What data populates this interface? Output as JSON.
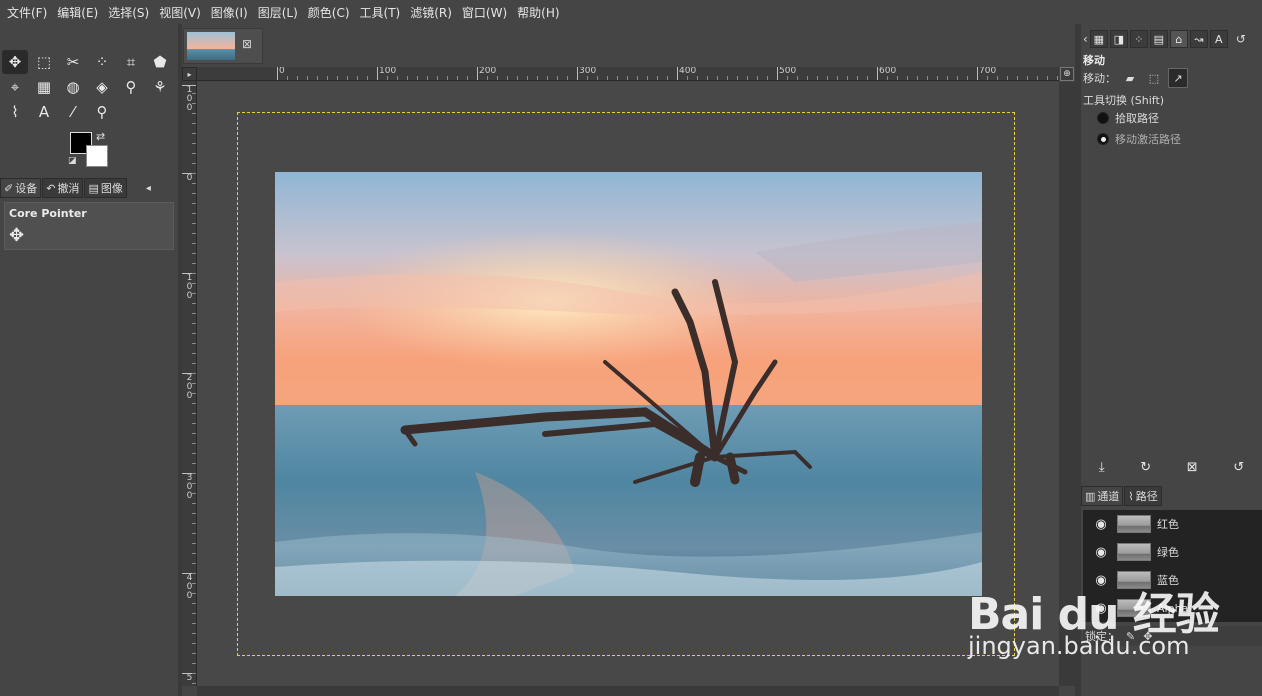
{
  "menubar": {
    "items": [
      "文件(F)",
      "编辑(E)",
      "选择(S)",
      "视图(V)",
      "图像(I)",
      "图层(L)",
      "颜色(C)",
      "工具(T)",
      "滤镜(R)",
      "窗口(W)",
      "帮助(H)"
    ]
  },
  "toolbox": {
    "tools": [
      {
        "name": "move-tool-icon",
        "glyph": "✥"
      },
      {
        "name": "rect-select-icon",
        "glyph": "⬚"
      },
      {
        "name": "scissors-select-icon",
        "glyph": "✂"
      },
      {
        "name": "fuzzy-select-icon",
        "glyph": "⁘"
      },
      {
        "name": "crop-icon",
        "glyph": "⌗"
      },
      {
        "name": "transform-icon",
        "glyph": "⬟"
      },
      {
        "name": "perspective-icon",
        "glyph": "⌖"
      },
      {
        "name": "warp-icon",
        "glyph": "▦"
      },
      {
        "name": "bucket-fill-icon",
        "glyph": "◍"
      },
      {
        "name": "eraser-icon",
        "glyph": "◈"
      },
      {
        "name": "clone-icon",
        "glyph": "⚲"
      },
      {
        "name": "smudge-icon",
        "glyph": "⚘"
      },
      {
        "name": "paths-icon",
        "glyph": "⌇"
      },
      {
        "name": "text-tool-icon",
        "glyph": "A"
      },
      {
        "name": "color-picker-icon",
        "glyph": "⁄"
      },
      {
        "name": "zoom-icon",
        "glyph": "⚲"
      }
    ],
    "fg_color": "#000000",
    "bg_color": "#ffffff"
  },
  "left_tabs": {
    "devices": "设备",
    "undo": "撤消",
    "images": "图像"
  },
  "device_panel": {
    "name": "Core Pointer"
  },
  "hruler": {
    "labels": [
      "0",
      "100",
      "200",
      "300",
      "400",
      "500",
      "600",
      "700"
    ]
  },
  "vruler": {
    "labels": [
      "1\n0\n0",
      "0",
      "1\n0\n0",
      "2\n0\n0",
      "3\n0\n0",
      "4\n0\n0",
      "5"
    ]
  },
  "tool_options": {
    "title": "移动",
    "move_label": "移动：",
    "toggle_label": "工具切换 (Shift)",
    "option_pick": "拾取路径",
    "option_active": "移动激活路径"
  },
  "channels_tabs": {
    "channels": "通道",
    "paths": "路径"
  },
  "channels": [
    {
      "label": "红色"
    },
    {
      "label": "绿色"
    },
    {
      "label": "蓝色"
    },
    {
      "label": "Alpha"
    }
  ],
  "lock_label": "锁定：",
  "watermark": {
    "main": "Bai du 经验",
    "sub": "jingyan.baidu.com"
  }
}
